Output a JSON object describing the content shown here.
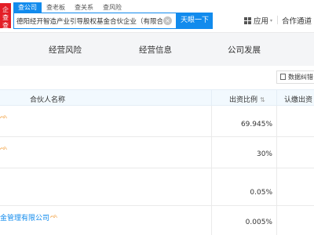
{
  "logo": {
    "text": "企查查"
  },
  "search": {
    "tabs": [
      {
        "label": "查公司",
        "active": true
      },
      {
        "label": "查老板",
        "active": false
      },
      {
        "label": "查关系",
        "active": false
      },
      {
        "label": "查风险",
        "active": false
      }
    ],
    "value": "德阳经开智造产业引导股权基金合伙企业（有限合伙）",
    "button_label": "天眼一下"
  },
  "header": {
    "apps_label": "应用",
    "partner_label": "合作通道"
  },
  "nav": {
    "items": [
      "经营风险",
      "经营信息",
      "公司发展"
    ]
  },
  "toolbar": {
    "correction_label": "数据纠错"
  },
  "table": {
    "headers": {
      "name": "合伙人名称",
      "ratio": "出资比例",
      "subscribed": "认缴出资"
    },
    "rows": [
      {
        "name": "",
        "ratio": "69.945%"
      },
      {
        "name": "",
        "ratio": "30%"
      },
      {
        "name": "",
        "ratio": "0.05%"
      },
      {
        "name": "金管理有限公司",
        "ratio": "0.005%"
      }
    ]
  },
  "colors": {
    "brand_blue": "#128bed",
    "logo_red": "#e31e26",
    "icon_orange": "#f08e1b"
  }
}
